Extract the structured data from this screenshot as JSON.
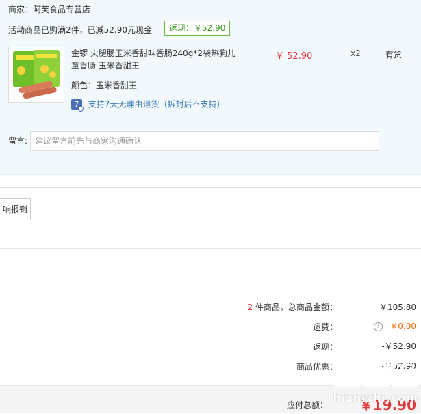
{
  "shop": {
    "merchant": "商家：阿芙食品专营店",
    "promo_text": "活动商品已购满2件，已减52.90元现金",
    "rebate_badge": "返现：￥52.90"
  },
  "item": {
    "name": "金锣 火腿肠玉米香甜味香肠240g*2袋热狗儿童香肠 玉米香甜王",
    "color": "颜色：玉米香甜王",
    "price": "￥ 52.90",
    "quantity": "x2",
    "stock": "有货",
    "return_icon_text": "7",
    "return_policy": "支持7天无理由退货（拆封后不支持）"
  },
  "note": {
    "label": "留言:",
    "placeholder": "建议留言前先与商家沟通确认"
  },
  "invoice": {
    "button_label": "响报销"
  },
  "summary": {
    "count": "2",
    "count_label": " 件商品，总商品金额：",
    "goods_total": "￥105.80",
    "shipping_label": "运费：",
    "shipping_value": "￥0.00",
    "rebate_label": "返现：",
    "rebate_value": "-￥52.90",
    "discount_label": "商品优惠：",
    "discount_value": "-￥52.90",
    "payable_label": "应付总额：",
    "payable_value": "￥19.90"
  },
  "watermark": {
    "text": "hizhizhi.com"
  },
  "colors": {
    "price_red": "#e4393c",
    "shipping_orange": "#ff6600",
    "rebate_green": "#3c9b27",
    "panel_bg": "#f1f9fd"
  }
}
